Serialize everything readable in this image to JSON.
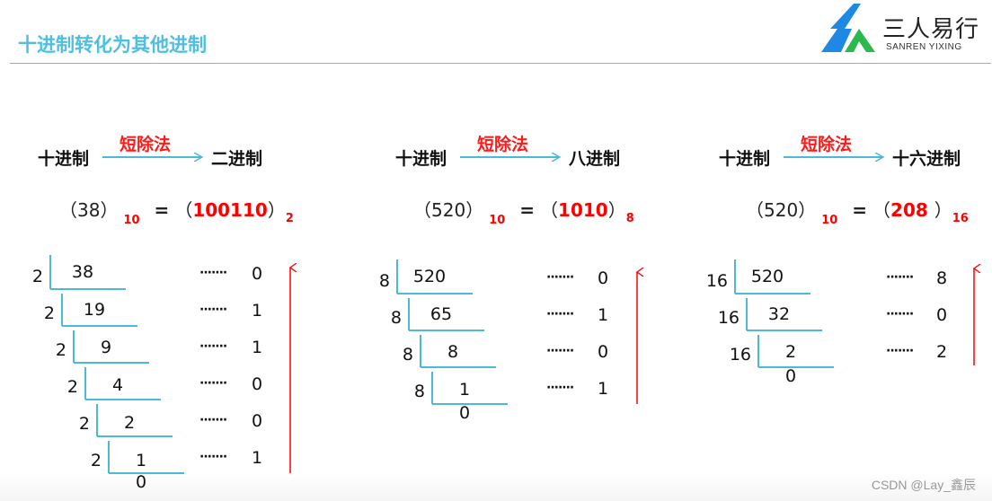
{
  "header": {
    "title": "十进制转化为其他进制",
    "logo": {
      "name_cn": "三人易行",
      "name_en": "SANREN YIXING",
      "colors": {
        "blue": "#1e88e5",
        "green": "#2db84d"
      }
    }
  },
  "colors": {
    "title": "#4fbfe0",
    "bracket": "#4db8d8",
    "arrow_red": "#ff0000",
    "result_red": "#ff0000"
  },
  "conversions": [
    {
      "from": "十进制",
      "method": "短除法",
      "to": "二进制",
      "equation": {
        "input": "38",
        "input_base": "10",
        "result": "100110",
        "result_base": "2"
      },
      "divisor": "2",
      "steps": [
        {
          "divisor": "2",
          "dividend": "38",
          "remainder": "0"
        },
        {
          "divisor": "2",
          "dividend": "19",
          "remainder": "1"
        },
        {
          "divisor": "2",
          "dividend": "9",
          "remainder": "1"
        },
        {
          "divisor": "2",
          "dividend": "4",
          "remainder": "0"
        },
        {
          "divisor": "2",
          "dividend": "2",
          "remainder": "0"
        },
        {
          "divisor": "2",
          "dividend": "1",
          "remainder": "1"
        }
      ],
      "final_quotient": "0"
    },
    {
      "from": "十进制",
      "method": "短除法",
      "to": "八进制",
      "equation": {
        "input": "520",
        "input_base": "10",
        "result": "1010",
        "result_base": "8"
      },
      "divisor": "8",
      "steps": [
        {
          "divisor": "8",
          "dividend": "520",
          "remainder": "0"
        },
        {
          "divisor": "8",
          "dividend": "65",
          "remainder": "1"
        },
        {
          "divisor": "8",
          "dividend": "8",
          "remainder": "0"
        },
        {
          "divisor": "8",
          "dividend": "1",
          "remainder": "1"
        }
      ],
      "final_quotient": "0"
    },
    {
      "from": "十进制",
      "method": "短除法",
      "to": "十六进制",
      "equation": {
        "input": "520",
        "input_base": "10",
        "result": "208 ",
        "result_base": "16"
      },
      "divisor": "16",
      "steps": [
        {
          "divisor": "16",
          "dividend": "520",
          "remainder": "8"
        },
        {
          "divisor": "16",
          "dividend": "32",
          "remainder": "0"
        },
        {
          "divisor": "16",
          "dividend": "2",
          "remainder": "2"
        }
      ],
      "final_quotient": "0"
    }
  ],
  "symbols": {
    "dots": "·······",
    "equals": "=",
    "lparen": "（",
    "rparen": "）"
  },
  "watermark": "CSDN @Lay_鑫辰"
}
